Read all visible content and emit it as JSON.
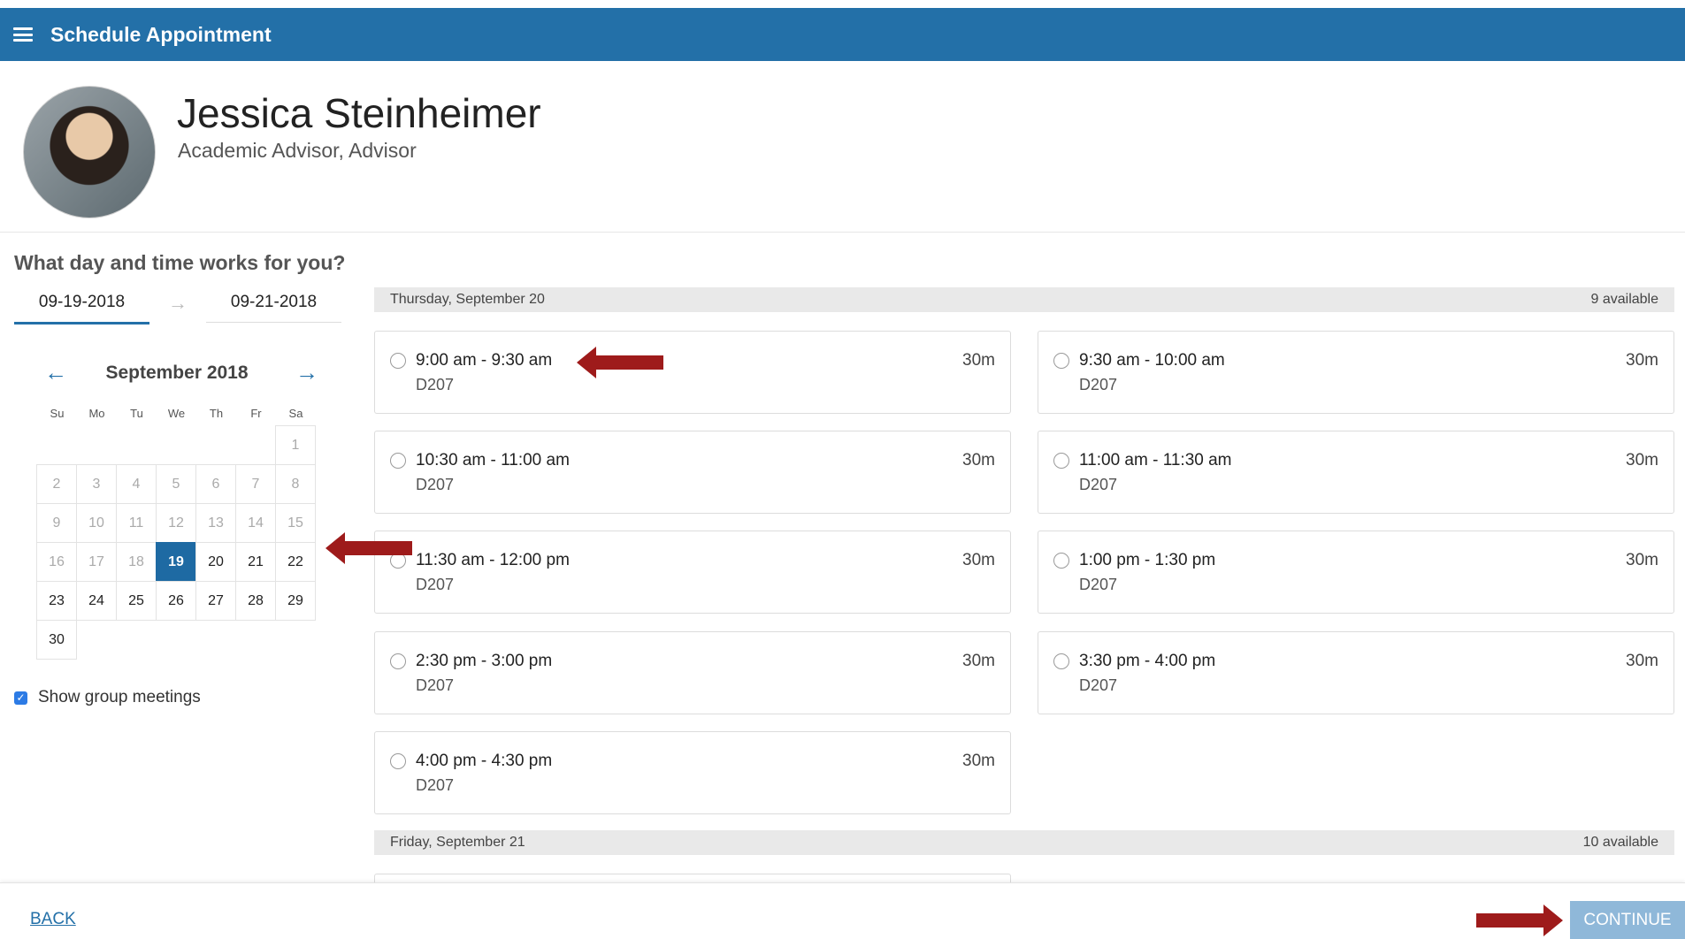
{
  "header": {
    "title": "Schedule Appointment"
  },
  "profile": {
    "name": "Jessica Steinheimer",
    "role": "Academic Advisor, Advisor"
  },
  "question": "What day and time works for you?",
  "date_range": {
    "from": "09-19-2018",
    "to": "09-21-2018"
  },
  "calendar": {
    "month_label": "September 2018",
    "dow": [
      "Su",
      "Mo",
      "Tu",
      "We",
      "Th",
      "Fr",
      "Sa"
    ],
    "selected_day": 19,
    "days": [
      {
        "label": "",
        "state": "empty"
      },
      {
        "label": "",
        "state": "empty"
      },
      {
        "label": "",
        "state": "empty"
      },
      {
        "label": "",
        "state": "empty"
      },
      {
        "label": "",
        "state": "empty"
      },
      {
        "label": "",
        "state": "empty"
      },
      {
        "label": "1",
        "state": "disabled"
      },
      {
        "label": "2",
        "state": "disabled"
      },
      {
        "label": "3",
        "state": "disabled"
      },
      {
        "label": "4",
        "state": "disabled"
      },
      {
        "label": "5",
        "state": "disabled"
      },
      {
        "label": "6",
        "state": "disabled"
      },
      {
        "label": "7",
        "state": "disabled"
      },
      {
        "label": "8",
        "state": "disabled"
      },
      {
        "label": "9",
        "state": "disabled"
      },
      {
        "label": "10",
        "state": "disabled"
      },
      {
        "label": "11",
        "state": "disabled"
      },
      {
        "label": "12",
        "state": "disabled"
      },
      {
        "label": "13",
        "state": "disabled"
      },
      {
        "label": "14",
        "state": "disabled"
      },
      {
        "label": "15",
        "state": "disabled"
      },
      {
        "label": "16",
        "state": "disabled"
      },
      {
        "label": "17",
        "state": "disabled"
      },
      {
        "label": "18",
        "state": "disabled"
      },
      {
        "label": "19",
        "state": "selected"
      },
      {
        "label": "20",
        "state": "active"
      },
      {
        "label": "21",
        "state": "active"
      },
      {
        "label": "22",
        "state": "active"
      },
      {
        "label": "23",
        "state": "active"
      },
      {
        "label": "24",
        "state": "active"
      },
      {
        "label": "25",
        "state": "active"
      },
      {
        "label": "26",
        "state": "active"
      },
      {
        "label": "27",
        "state": "active"
      },
      {
        "label": "28",
        "state": "active"
      },
      {
        "label": "29",
        "state": "active"
      },
      {
        "label": "30",
        "state": "active"
      }
    ]
  },
  "group_meetings": {
    "label": "Show group meetings",
    "checked": true
  },
  "days": [
    {
      "label": "Thursday, September 20",
      "available": "9 available",
      "slots": [
        {
          "time": "9:00 am - 9:30 am",
          "room": "D207",
          "duration": "30m"
        },
        {
          "time": "9:30 am - 10:00 am",
          "room": "D207",
          "duration": "30m"
        },
        {
          "time": "10:30 am - 11:00 am",
          "room": "D207",
          "duration": "30m"
        },
        {
          "time": "11:00 am - 11:30 am",
          "room": "D207",
          "duration": "30m"
        },
        {
          "time": "11:30 am - 12:00 pm",
          "room": "D207",
          "duration": "30m"
        },
        {
          "time": "1:00 pm - 1:30 pm",
          "room": "D207",
          "duration": "30m"
        },
        {
          "time": "2:30 pm - 3:00 pm",
          "room": "D207",
          "duration": "30m"
        },
        {
          "time": "3:30 pm - 4:00 pm",
          "room": "D207",
          "duration": "30m"
        },
        {
          "time": "4:00 pm - 4:30 pm",
          "room": "D207",
          "duration": "30m"
        }
      ]
    },
    {
      "label": "Friday, September 21",
      "available": "10 available"
    }
  ],
  "footer": {
    "back_label": "BACK",
    "continue_label": "CONTINUE"
  },
  "colors": {
    "header_bg": "#2370a8",
    "selected_day": "#1e6aa3",
    "continue_bg": "#8fb8d9",
    "annotation_arrow": "#9e1b1b"
  }
}
